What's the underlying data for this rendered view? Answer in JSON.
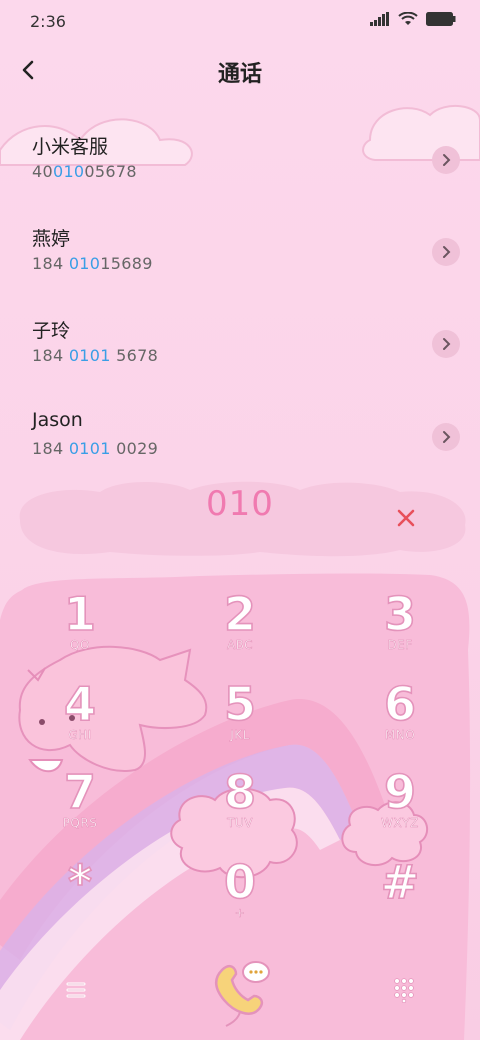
{
  "status_bar": {
    "time": "2:36"
  },
  "header": {
    "title": "通话"
  },
  "contacts": [
    {
      "name": "小米客服",
      "number_pre": "40",
      "number_hl": "010",
      "number_post": "05678"
    },
    {
      "name": "燕婷",
      "number_pre": "184 ",
      "number_hl": "010",
      "number_post": "15689"
    },
    {
      "name": "子玲",
      "number_pre": "184 ",
      "number_hl": "0101",
      "number_post": " 5678"
    },
    {
      "name": "Jason",
      "number_pre": "184 ",
      "number_hl": "0101",
      "number_post": " 0029"
    }
  ],
  "dial_input": {
    "value": "010"
  },
  "keypad": {
    "k1": {
      "digit": "1",
      "letters": "QO"
    },
    "k2": {
      "digit": "2",
      "letters": "ABC"
    },
    "k3": {
      "digit": "3",
      "letters": "DEF"
    },
    "k4": {
      "digit": "4",
      "letters": "GHI"
    },
    "k5": {
      "digit": "5",
      "letters": "JKL"
    },
    "k6": {
      "digit": "6",
      "letters": "MNO"
    },
    "k7": {
      "digit": "7",
      "letters": "PQRS"
    },
    "k8": {
      "digit": "8",
      "letters": "TUV"
    },
    "k9": {
      "digit": "9",
      "letters": "WXYZ"
    },
    "kstar": {
      "digit": "*",
      "letters": ""
    },
    "k0": {
      "digit": "0",
      "letters": "+"
    },
    "khash": {
      "digit": "#",
      "letters": ""
    }
  },
  "icons": {
    "back": "chevron-left-icon",
    "clear": "close-icon",
    "menu": "menu-icon",
    "call": "phone-call-icon",
    "dialpad": "dialpad-icon"
  },
  "colors": {
    "accent_pink": "#f07ab0",
    "highlight_blue": "#3a9ee6",
    "clear_red": "#e8505b"
  }
}
